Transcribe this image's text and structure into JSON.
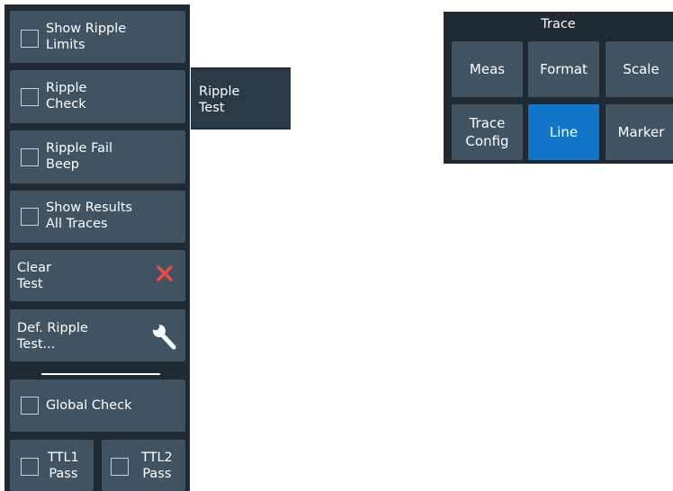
{
  "left_panel": {
    "show_ripple_limits": {
      "label": "Show Ripple\nLimits",
      "checked": false
    },
    "ripple_check": {
      "label": "Ripple\nCheck",
      "checked": false
    },
    "ripple_fail_beep": {
      "label": "Ripple Fail\nBeep",
      "checked": false
    },
    "show_results_all_traces": {
      "label": "Show Results\nAll Traces",
      "checked": false
    },
    "clear_test": {
      "label": "Clear\nTest",
      "icon": "close-icon",
      "icon_color": "#f0474b"
    },
    "def_ripple_test": {
      "label": "Def. Ripple\nTest...",
      "icon": "wrench-icon"
    },
    "global_check": {
      "label": "Global Check",
      "checked": false
    },
    "ttl1_pass": {
      "label": "TTL1\nPass",
      "checked": false
    },
    "ttl2_pass": {
      "label": "TTL2\nPass",
      "checked": false
    }
  },
  "submenu": {
    "ripple_test": "Ripple\nTest"
  },
  "trace_panel": {
    "title": "Trace",
    "buttons": [
      {
        "label": "Meas",
        "active": false
      },
      {
        "label": "Format",
        "active": false
      },
      {
        "label": "Scale",
        "active": false
      },
      {
        "label": "Trace\nConfig",
        "active": false
      },
      {
        "label": "Line",
        "active": true
      },
      {
        "label": "Marker",
        "active": false
      }
    ]
  },
  "colors": {
    "panel_bg": "#1f2a34",
    "button_bg": "#3f5363",
    "active_button_bg": "#1276c8",
    "text": "#ffffff"
  }
}
